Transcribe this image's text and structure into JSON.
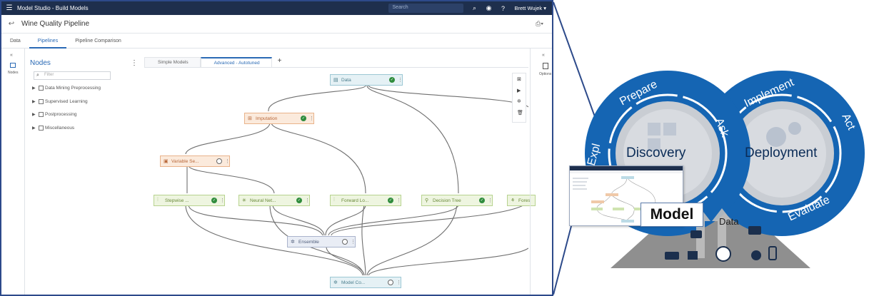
{
  "topbar": {
    "app_title": "Model Studio - Build Models",
    "search_placeholder": "Search",
    "user_name": "Brett Wujek ▾"
  },
  "project": {
    "title": "Wine Quality Pipeline"
  },
  "main_tabs": [
    "Data",
    "Pipelines",
    "Pipeline Comparison"
  ],
  "active_main_tab": "Pipelines",
  "left_rail": {
    "label": "Nodes"
  },
  "right_rail": {
    "label": "Options"
  },
  "nodes_panel": {
    "title": "Nodes",
    "filter_placeholder": "Filter",
    "categories": [
      "Data Mining Preprocessing",
      "Supervised Learning",
      "Postprocessing",
      "Miscellaneous"
    ]
  },
  "pipeline_tabs": [
    "Simple Models",
    "Advanced - Autotuned"
  ],
  "active_pipeline_tab": "Advanced - Autotuned",
  "pipeline_nodes": {
    "data": {
      "label": "Data",
      "status": "done"
    },
    "imputation": {
      "label": "Imputation",
      "status": "done"
    },
    "variable_selection": {
      "label": "Variable Se...",
      "status": "pending"
    },
    "stepwise": {
      "label": "Stepwise ...",
      "status": "done"
    },
    "neural_net": {
      "label": "Neural Net...",
      "status": "done"
    },
    "forward": {
      "label": "Forward Lo...",
      "status": "done"
    },
    "decision_tree": {
      "label": "Decision Tree",
      "status": "done"
    },
    "forest": {
      "label": "Fores",
      "status": "done"
    },
    "ensemble": {
      "label": "Ensemble",
      "status": "pending"
    },
    "model_comparison": {
      "label": "Model Co...",
      "status": "pending"
    }
  },
  "lifecycle": {
    "discovery_label": "Discovery",
    "deployment_label": "Deployment",
    "discovery_steps": [
      "Prepare",
      "Ask",
      "Expl"
    ],
    "deployment_steps": [
      "Implement",
      "Act",
      "Evaluate"
    ],
    "model_label": "Model",
    "data_label": "Data",
    "ring_color": "#1565b3",
    "inner_color": "#c9cdd3"
  }
}
